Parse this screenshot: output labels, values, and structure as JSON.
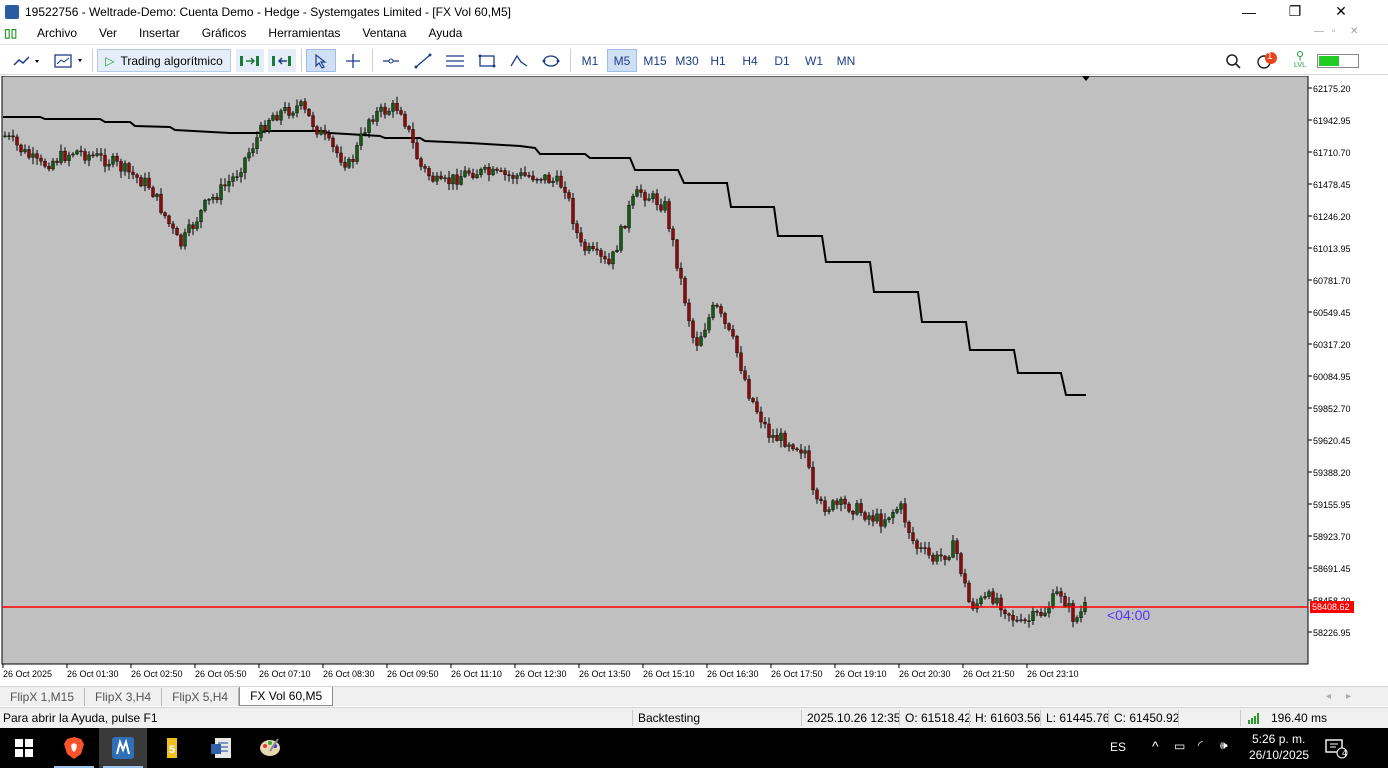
{
  "window": {
    "title": "19522756 - Weltrade-Demo: Cuenta Demo - Hedge - Systemgates Limited - [FX Vol 60,M5]",
    "controls": {
      "minimize": "—",
      "maximize": "❐",
      "close": "✕"
    }
  },
  "menu": {
    "items": [
      "Archivo",
      "Ver",
      "Insertar",
      "Gráficos",
      "Herramientas",
      "Ventana",
      "Ayuda"
    ]
  },
  "toolbar": {
    "algo_label": "Trading algorítmico",
    "timeframes": [
      "M1",
      "M5",
      "M15",
      "M30",
      "H1",
      "H4",
      "D1",
      "W1",
      "MN"
    ],
    "active_timeframe": "M5",
    "notification_count": "1",
    "signal_label": "LVL"
  },
  "chart": {
    "background": "#c0c0c0",
    "bull_color": "#145a14",
    "bear_color": "#8b0a0a",
    "ask_line_color": "#ff0000",
    "current_price_label": "58408.62",
    "countdown": "<04:00",
    "price_ticks": [
      "62175.20",
      "61942.95",
      "61710.70",
      "61478.45",
      "61246.20",
      "61013.95",
      "60781.70",
      "60549.45",
      "60317.20",
      "60084.95",
      "59852.70",
      "59620.45",
      "59388.20",
      "59155.95",
      "58923.70",
      "58691.45",
      "58458.20",
      "58226.95"
    ],
    "time_ticks": [
      "26 Oct 2025",
      "26 Oct 01:30",
      "26 Oct 02:50",
      "26 Oct 05:50",
      "26 Oct 07:10",
      "26 Oct 08:30",
      "26 Oct 09:50",
      "26 Oct 11:10",
      "26 Oct 12:30",
      "26 Oct 13:50",
      "26 Oct 15:10",
      "26 Oct 16:30",
      "26 Oct 17:50",
      "26 Oct 19:10",
      "26 Oct 20:30",
      "26 Oct 21:50",
      "26 Oct 23:10"
    ]
  },
  "tabs": [
    "FlipX 1,M15",
    "FlipX 3,H4",
    "FlipX 5,H4",
    "FX Vol 60,M5"
  ],
  "active_tab": "FX Vol 60,M5",
  "status": {
    "help": "Para abrir la Ayuda, pulse F1",
    "mode": "Backtesting",
    "datetime": "2025.10.26 12:35",
    "open": "O: 61518.42",
    "high": "H: 61603.56",
    "low": "L: 61445.76",
    "close": "C: 61450.92",
    "ping": "196.40 ms"
  },
  "taskbar": {
    "lang": "ES",
    "time": "5:26 p. m.",
    "date": "26/10/2025",
    "notif_count": "4"
  }
}
